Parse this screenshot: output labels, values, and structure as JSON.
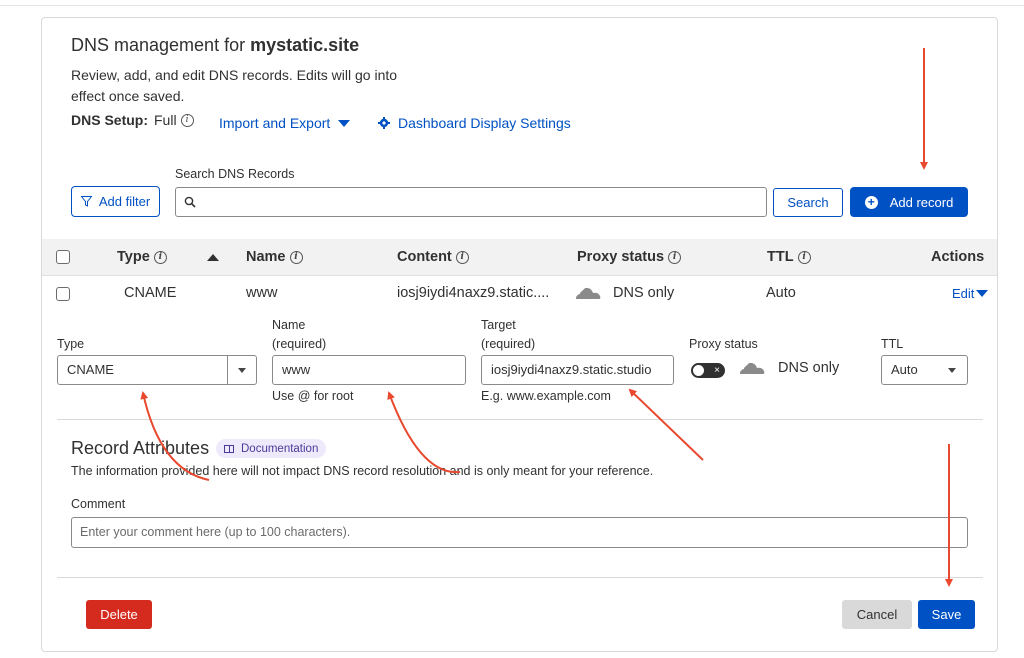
{
  "header": {
    "title_prefix": "DNS management for ",
    "domain": "mystatic.site",
    "description": "Review, add, and edit DNS records. Edits will go into effect once saved.",
    "dns_setup_label": "DNS Setup:",
    "dns_setup_value": "Full",
    "import_export_label": "Import and Export",
    "dashboard_settings_label": "Dashboard Display Settings"
  },
  "search": {
    "label": "Search DNS Records",
    "placeholder": "",
    "add_filter_label": "Add filter",
    "search_button_label": "Search",
    "add_record_label": "Add record"
  },
  "table": {
    "columns": [
      "Type",
      "Name",
      "Content",
      "Proxy status",
      "TTL",
      "Actions"
    ],
    "rows": [
      {
        "type": "CNAME",
        "name": "www",
        "content": "iosj9iydi4naxz9.static....",
        "proxy_status": "DNS only",
        "ttl": "Auto",
        "action": "Edit"
      }
    ]
  },
  "edit_form": {
    "type_label": "Type",
    "type_value": "CNAME",
    "name_label": "Name",
    "name_required": "(required)",
    "name_value": "www",
    "name_hint": "Use @ for root",
    "target_label": "Target",
    "target_required": "(required)",
    "target_value": "iosj9iydi4naxz9.static.studio",
    "target_hint": "E.g. www.example.com",
    "proxy_label": "Proxy status",
    "proxy_value": "DNS only",
    "ttl_label": "TTL",
    "ttl_value": "Auto"
  },
  "record_attributes": {
    "title": "Record Attributes",
    "doc_label": "Documentation",
    "description": "The information provided here will not impact DNS record resolution and is only meant for your reference.",
    "comment_label": "Comment",
    "comment_placeholder": "Enter your comment here (up to 100 characters)."
  },
  "footer": {
    "delete_label": "Delete",
    "cancel_label": "Cancel",
    "save_label": "Save"
  },
  "colors": {
    "accent": "#0051c3",
    "danger": "#d52b1e",
    "annotation_arrow": "#e8492f"
  }
}
